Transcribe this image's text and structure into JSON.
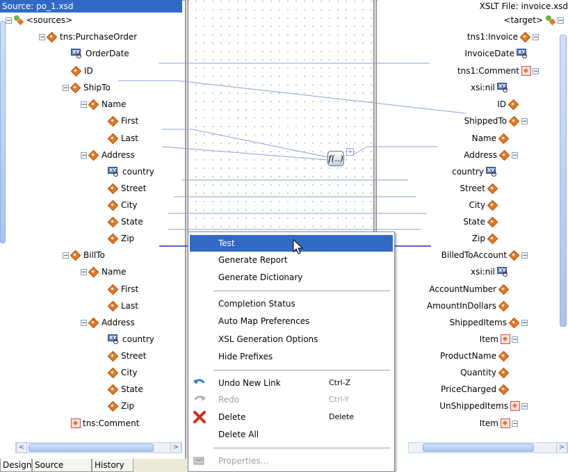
{
  "source_header": "Source: po_1.xsd",
  "target_header": "XSLT File: invoice.xsd",
  "source_tree": [
    {
      "label": "<sources>"
    },
    {
      "label": "tns:PurchaseOrder"
    },
    {
      "label": "OrderDate"
    },
    {
      "label": "ID"
    },
    {
      "label": "ShipTo"
    },
    {
      "label": "Name"
    },
    {
      "label": "First"
    },
    {
      "label": "Last"
    },
    {
      "label": "Address"
    },
    {
      "label": "country"
    },
    {
      "label": "Street"
    },
    {
      "label": "City"
    },
    {
      "label": "State"
    },
    {
      "label": "Zip"
    },
    {
      "label": "BillTo"
    },
    {
      "label": "Name"
    },
    {
      "label": "First"
    },
    {
      "label": "Last"
    },
    {
      "label": "Address"
    },
    {
      "label": "country"
    },
    {
      "label": "Street"
    },
    {
      "label": "City"
    },
    {
      "label": "State"
    },
    {
      "label": "Zip"
    },
    {
      "label": "tns:Comment"
    }
  ],
  "target_tree": [
    {
      "label": "<target>"
    },
    {
      "label": "tns1:Invoice"
    },
    {
      "label": "InvoiceDate"
    },
    {
      "label": "tns1:Comment"
    },
    {
      "label": "xsi:nil"
    },
    {
      "label": "ID"
    },
    {
      "label": "ShippedTo"
    },
    {
      "label": "Name"
    },
    {
      "label": "Address"
    },
    {
      "label": "country"
    },
    {
      "label": "Street"
    },
    {
      "label": "City"
    },
    {
      "label": "State"
    },
    {
      "label": "Zip"
    },
    {
      "label": "BilledToAccount"
    },
    {
      "label": "xsi:nil"
    },
    {
      "label": "AccountNumber"
    },
    {
      "label": "AmountInDollars"
    },
    {
      "label": "ShippedItems"
    },
    {
      "label": "Item"
    },
    {
      "label": "ProductName"
    },
    {
      "label": "Quantity"
    },
    {
      "label": "PriceCharged"
    },
    {
      "label": "UnShippedItems"
    },
    {
      "label": "Item"
    }
  ],
  "function_label": "f(..)",
  "tabs": [
    "Design",
    "Source",
    "History"
  ],
  "menu": {
    "test": "Test",
    "generate_report": "Generate Report",
    "generate_dictionary": "Generate Dictionary",
    "completion_status": "Completion Status",
    "auto_map_preferences": "Auto Map Preferences",
    "xsl_generation_options": "XSL Generation Options",
    "hide_prefixes": "Hide Prefixes",
    "undo_new_link": "Undo New Link",
    "undo_shortcut": "Ctrl-Z",
    "redo": "Redo",
    "redo_shortcut": "Ctrl-Y",
    "delete": "Delete",
    "delete_shortcut": "Delete",
    "delete_all": "Delete All",
    "properties": "Properties..."
  },
  "colors": {
    "selection": "#316ac5",
    "mapping_line": "#8b9fd6",
    "active_line": "#1a2fb5",
    "node_orange": "#e87722"
  }
}
